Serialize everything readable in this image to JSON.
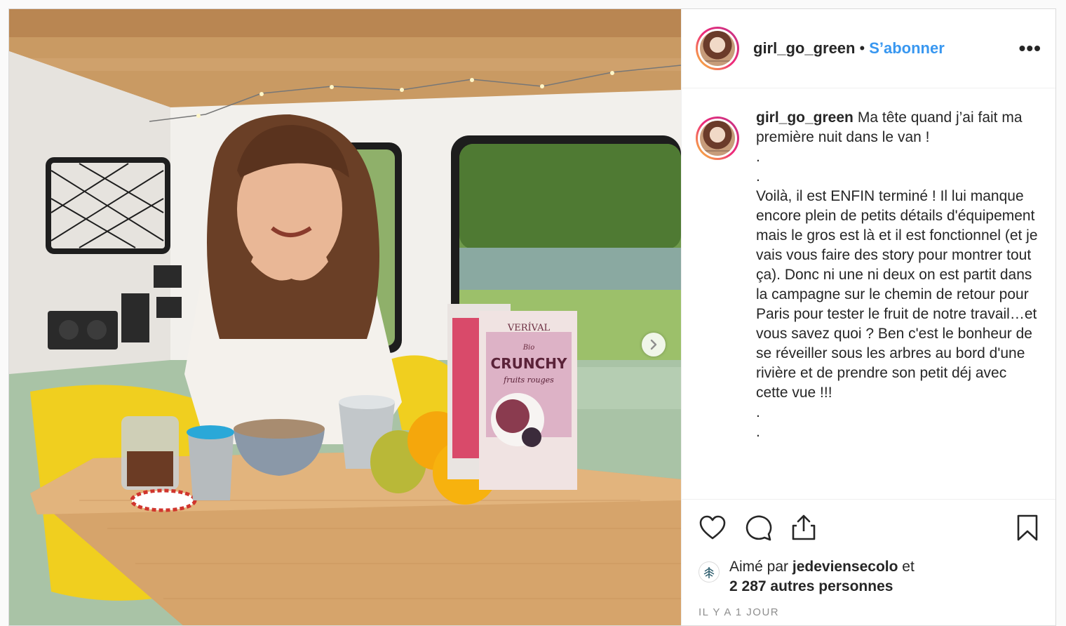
{
  "post": {
    "username": "girl_go_green",
    "separator": "•",
    "follow_label": "S’abonner",
    "more_label": "•••",
    "avatar_icon": "profile-avatar",
    "caption": {
      "username": "girl_go_green",
      "intro": "Ma tête quand j’ai fait ma première nuit dans le van !",
      "dots_1": ".",
      "dots_2": ".",
      "body": "Voilà, il est ENFIN terminé ! Il lui manque encore plein de petits détails d'équipement mais le gros est là et il est fonctionnel (et je vais vous faire des story pour montrer tout ça). Donc ni une ni deux on est partit dans la campagne sur le chemin de retour pour Paris pour tester le fruit de notre travail…et vous savez quoi ? Ben c'est le bonheur de se réveiller sous les arbres au bord d'une rivière et de prendre son petit déj avec cette vue !!!",
      "dots_3": ".",
      "dots_4": "."
    },
    "likes": {
      "prefix": "Aimé par",
      "user": "jedeviensecolo",
      "suffix": "et",
      "others": "2 287 autres personnes"
    },
    "timestamp": "IL Y A 1 JOUR",
    "photo": {
      "box_brand": "VERÍVAL",
      "box_sub": "Bio",
      "box_product": "CRUNCHY",
      "box_flavor": "fruits rouges",
      "second_brand": "VERÍVAL"
    },
    "icons": {
      "like": "heart-icon",
      "comment": "comment-icon",
      "share": "share-icon",
      "save": "bookmark-icon",
      "next": "chevron-right-icon"
    },
    "colors": {
      "link_blue": "#3897f0",
      "text": "#262626",
      "muted": "#8e8e8e",
      "border": "#dbdbdb"
    }
  }
}
